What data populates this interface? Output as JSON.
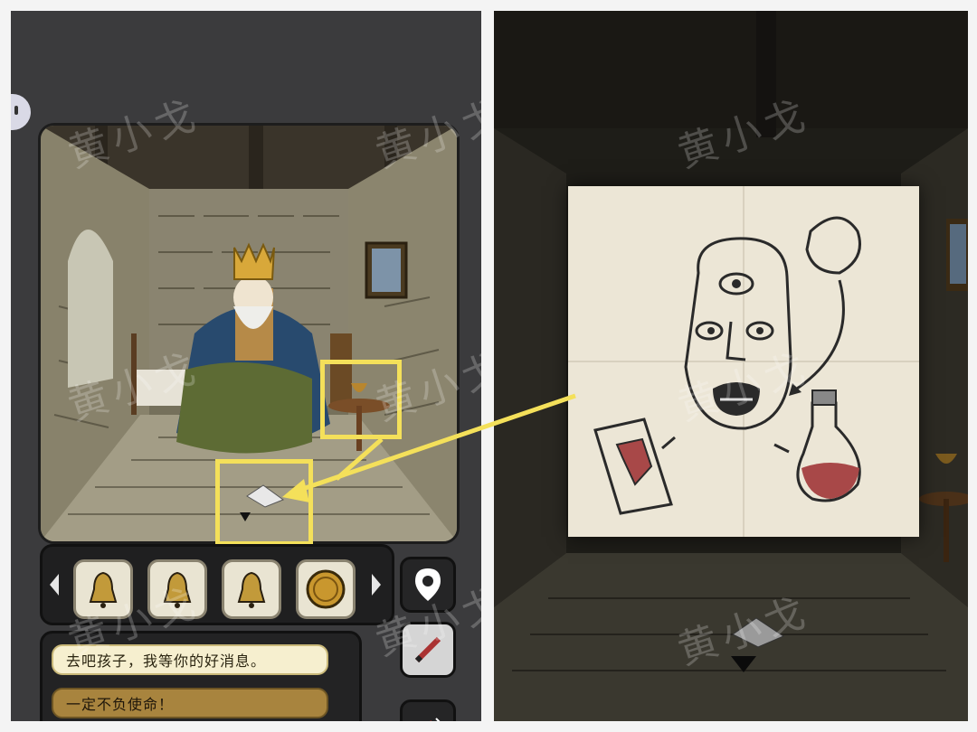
{
  "watermark": "黄小戈",
  "left_panel": {
    "inventory": {
      "items": [
        {
          "name": "bell",
          "icon": "bell-icon"
        },
        {
          "name": "bell",
          "icon": "bell-icon"
        },
        {
          "name": "bell",
          "icon": "bell-icon"
        },
        {
          "name": "coin",
          "icon": "coin-icon"
        }
      ]
    },
    "dialogue": {
      "king_line": "去吧孩子，我等你的好消息。",
      "player_reply": "一定不负使命！"
    }
  },
  "colors": {
    "highlight": "#f4e05a",
    "dialogue_npc_bg": "#f6efcf",
    "dialogue_player_bg": "#a8843e"
  }
}
